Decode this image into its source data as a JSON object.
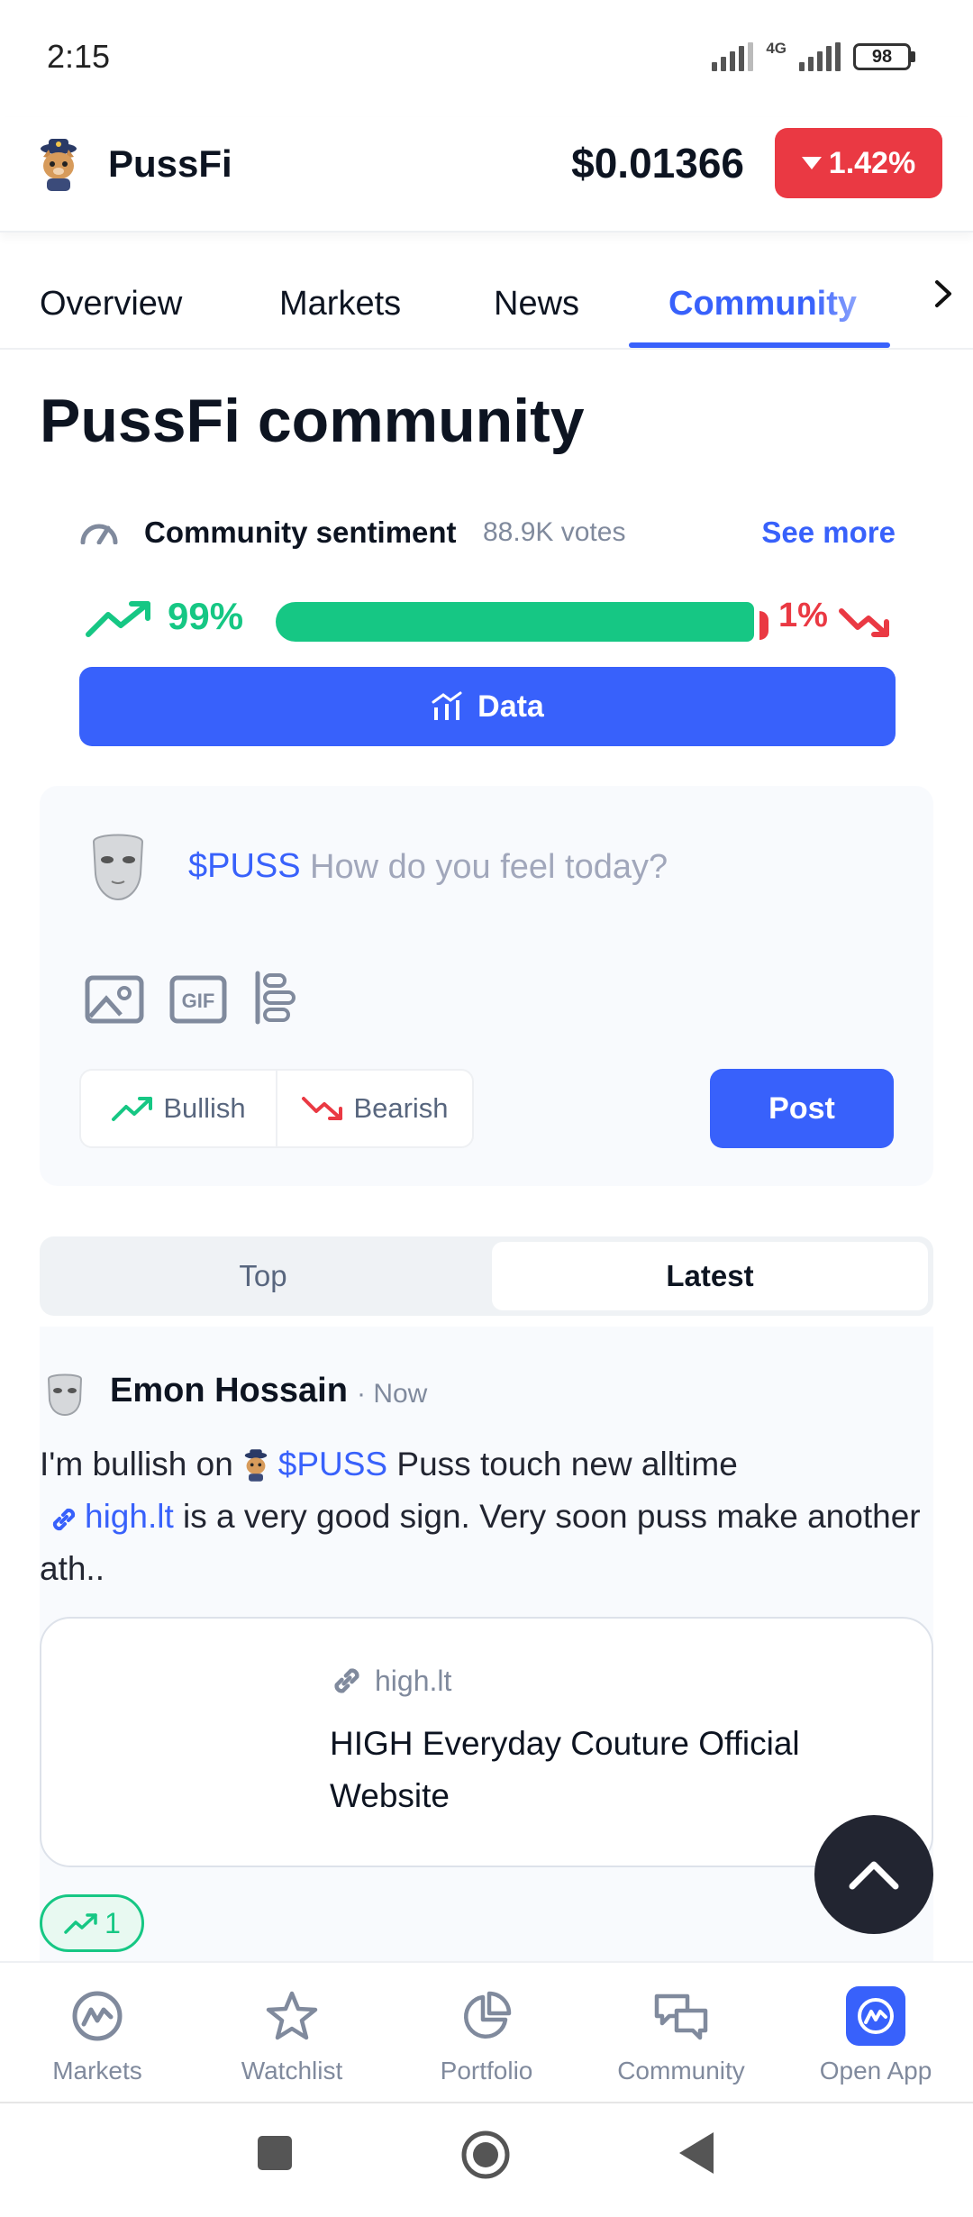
{
  "status_bar": {
    "time": "2:15",
    "network": "4G",
    "battery": "98"
  },
  "header": {
    "coin_name": "PussFi",
    "price": "$0.01366",
    "change": "1.42%",
    "change_color": "#ea3943",
    "logo_icon": "puss-cat-logo"
  },
  "tabs": [
    {
      "label": "Overview"
    },
    {
      "label": "Markets"
    },
    {
      "label": "News"
    },
    {
      "label": "Community",
      "active": true
    }
  ],
  "page_title": "PussFi community",
  "sentiment": {
    "label": "Community sentiment",
    "votes": "88.9K votes",
    "see_more": "See more",
    "bullish_pct": "99%",
    "bearish_pct": "1%",
    "bullish_fraction": 0.99,
    "bullish_color": "#16c784",
    "bearish_color": "#ea3943"
  },
  "data_button": {
    "label": "Data"
  },
  "compose": {
    "ticker": "$PUSS",
    "placeholder": "How do you feel today?",
    "bullish_label": "Bullish",
    "bearish_label": "Bearish",
    "post_label": "Post",
    "tools": [
      "image-icon",
      "gif-icon",
      "poll-icon"
    ]
  },
  "feed": {
    "tabs": [
      {
        "label": "Top",
        "active": false
      },
      {
        "label": "Latest",
        "active": true
      }
    ]
  },
  "post": {
    "author": "Emon Hossain",
    "time": "· Now",
    "text_prefix": "I'm bullish on",
    "ticker": "$PUSS",
    "text_middle": "Puss touch new alltime",
    "link_text": "high.lt",
    "text_suffix": "is a very good sign. Very soon puss make another ath..",
    "preview": {
      "domain": "high.lt",
      "title": "HIGH Everyday Couture Official Website"
    },
    "reaction_count": "1"
  },
  "bottom_nav": [
    {
      "label": "Markets",
      "icon": "cmc-logo-icon"
    },
    {
      "label": "Watchlist",
      "icon": "star-icon"
    },
    {
      "label": "Portfolio",
      "icon": "pie-chart-icon"
    },
    {
      "label": "Community",
      "icon": "chat-icon"
    },
    {
      "label": "Open App",
      "icon": "open-app-icon"
    }
  ],
  "accent_color": "#3861fb"
}
